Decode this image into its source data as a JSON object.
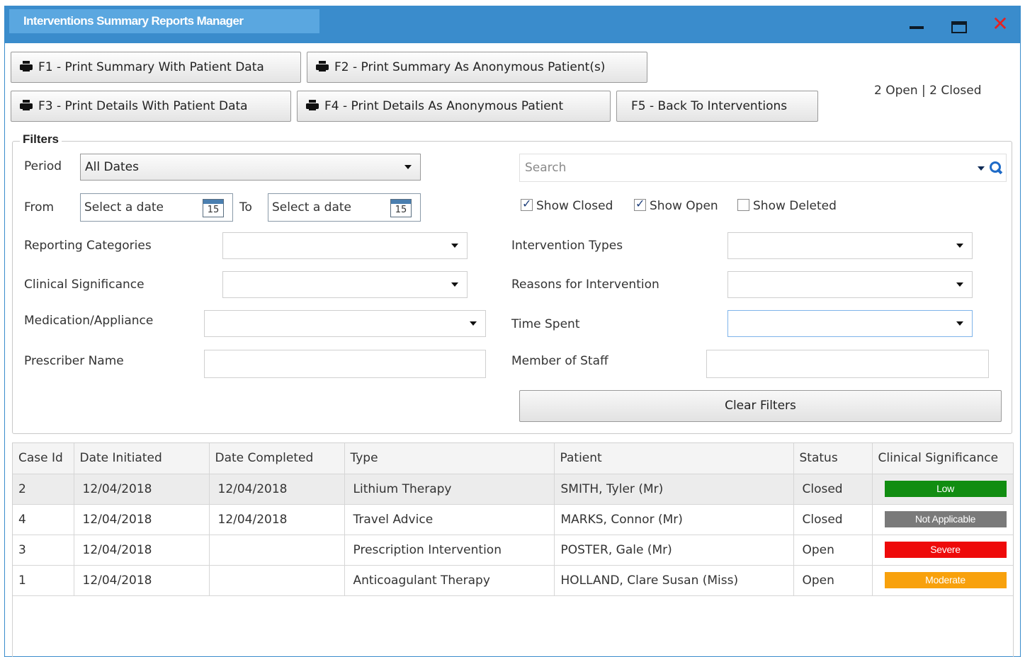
{
  "window": {
    "title": "Interventions Summary Reports Manager"
  },
  "toolbar": {
    "f1_label": "F1 -  Print Summary With Patient Data",
    "f2_label": "F2 -  Print Summary As Anonymous Patient(s)",
    "f3_label": "F3 -  Print Details With Patient Data",
    "f4_label": "F4 -  Print Details As Anonymous Patient",
    "f5_label": "F5 -  Back To Interventions"
  },
  "counts": {
    "text": "2 Open |  2 Closed"
  },
  "filters": {
    "title": "Filters",
    "period_label": "Period",
    "period_value": "All Dates",
    "from_label": "From",
    "to_label": "To",
    "date_placeholder": "Select a date",
    "calendar_day": "15",
    "search_placeholder": "Search",
    "show_closed": "Show Closed",
    "show_open": "Show Open",
    "show_deleted": "Show Deleted",
    "reporting_categories": "Reporting Categories",
    "clinical_significance": "Clinical Significance",
    "medication_appliance": "Medication/Appliance",
    "prescriber_name": "Prescriber Name",
    "intervention_types": "Intervention Types",
    "reasons_for_intervention": "Reasons for Intervention",
    "time_spent": "Time Spent",
    "member_of_staff": "Member of Staff",
    "clear_label": "Clear Filters"
  },
  "grid": {
    "headers": [
      "Case Id",
      "Date Initiated",
      "Date Completed",
      "Type",
      "Patient",
      "Status",
      "Clinical Significance"
    ],
    "rows": [
      {
        "case_id": "2",
        "initiated": "12/04/2018",
        "completed": "12/04/2018",
        "type": "Lithium Therapy",
        "patient": "SMITH, Tyler (Mr)",
        "status": "Closed",
        "significance": "Low",
        "color": "#118d11"
      },
      {
        "case_id": "4",
        "initiated": "12/04/2018",
        "completed": "12/04/2018",
        "type": "Travel Advice",
        "patient": "MARKS, Connor (Mr)",
        "status": "Closed",
        "significance": "Not Applicable",
        "color": "#7a7a7a"
      },
      {
        "case_id": "3",
        "initiated": "12/04/2018",
        "completed": "",
        "type": "Prescription Intervention",
        "patient": "POSTER, Gale (Mr)",
        "status": "Open",
        "significance": "Severe",
        "color": "#ee0a0a"
      },
      {
        "case_id": "1",
        "initiated": "12/04/2018",
        "completed": "",
        "type": "Anticoagulant Therapy",
        "patient": "HOLLAND, Clare Susan (Miss)",
        "status": "Open",
        "significance": "Moderate",
        "color": "#f8a10c"
      }
    ]
  }
}
